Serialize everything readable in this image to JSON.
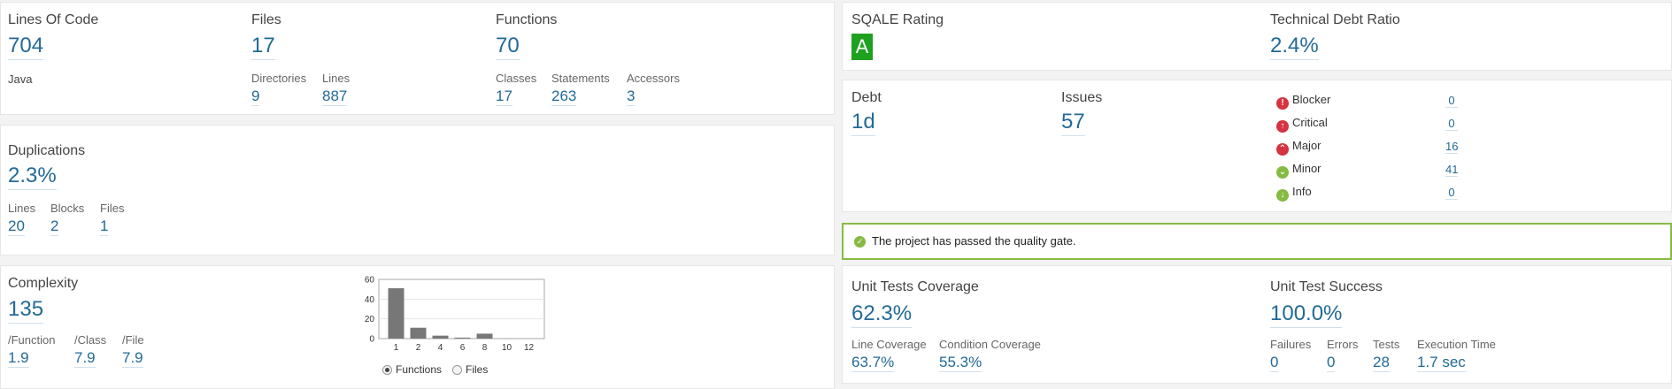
{
  "size": {
    "title": "Lines Of Code",
    "value": "704",
    "language": "Java",
    "files_title": "Files",
    "files_value": "17",
    "directories_label": "Directories",
    "directories_value": "9",
    "lines_label": "Lines",
    "lines_value": "887",
    "functions_title": "Functions",
    "functions_value": "70",
    "classes_label": "Classes",
    "classes_value": "17",
    "statements_label": "Statements",
    "statements_value": "263",
    "accessors_label": "Accessors",
    "accessors_value": "3"
  },
  "duplications": {
    "title": "Duplications",
    "value": "2.3%",
    "lines_label": "Lines",
    "lines_value": "20",
    "blocks_label": "Blocks",
    "blocks_value": "2",
    "files_label": "Files",
    "files_value": "1"
  },
  "complexity": {
    "title": "Complexity",
    "value": "135",
    "per_function_label": "/Function",
    "per_function_value": "1.9",
    "per_class_label": "/Class",
    "per_class_value": "7.9",
    "per_file_label": "/File",
    "per_file_value": "7.9",
    "radio_functions": "Functions",
    "radio_files": "Files",
    "selected": "Functions"
  },
  "chart_data": {
    "type": "bar",
    "categories": [
      "1",
      "2",
      "4",
      "6",
      "8",
      "10",
      "12"
    ],
    "values": [
      51,
      11,
      3,
      1,
      5,
      0,
      0
    ],
    "yticks": [
      "0",
      "20",
      "40",
      "60"
    ],
    "ylim": [
      0,
      60
    ],
    "bar_color": "#777777"
  },
  "rating": {
    "sqale_title": "SQALE Rating",
    "sqale_value": "A",
    "sqale_color": "#1ea11e",
    "debt_ratio_title": "Technical Debt Ratio",
    "debt_ratio_value": "2.4%"
  },
  "issues": {
    "debt_title": "Debt",
    "debt_value": "1d",
    "issues_title": "Issues",
    "issues_value": "57",
    "severities": [
      {
        "label": "Blocker",
        "count": "0",
        "icon": "blocker-icon",
        "color": "#d4333f"
      },
      {
        "label": "Critical",
        "count": "0",
        "icon": "critical-icon",
        "color": "#d4333f"
      },
      {
        "label": "Major",
        "count": "16",
        "icon": "major-icon",
        "color": "#d4333f"
      },
      {
        "label": "Minor",
        "count": "41",
        "icon": "minor-icon",
        "color": "#85bb43"
      },
      {
        "label": "Info",
        "count": "0",
        "icon": "info-icon",
        "color": "#85bb43"
      }
    ]
  },
  "quality_gate": {
    "message": "The project has passed the quality gate.",
    "border_color": "#85bb43"
  },
  "coverage": {
    "title": "Unit Tests Coverage",
    "value": "62.3%",
    "line_label": "Line Coverage",
    "line_value": "63.7%",
    "condition_label": "Condition Coverage",
    "condition_value": "55.3%"
  },
  "tests": {
    "title": "Unit Test Success",
    "value": "100.0%",
    "failures_label": "Failures",
    "failures_value": "0",
    "errors_label": "Errors",
    "errors_value": "0",
    "tests_label": "Tests",
    "tests_value": "28",
    "time_label": "Execution Time",
    "time_value": "1.7 sec"
  }
}
